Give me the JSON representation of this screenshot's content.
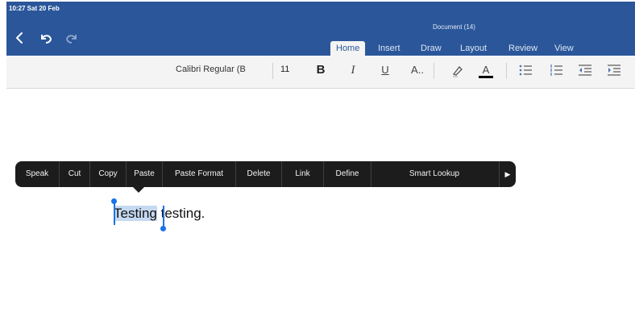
{
  "status_bar": {
    "time": "10:27  Sat 20 Feb"
  },
  "document_title": "Document (14)",
  "nav": {
    "back_icon": "chevron-left-icon",
    "undo_icon": "undo-icon",
    "redo_icon": "redo-icon"
  },
  "tabs": [
    {
      "label": "Home",
      "active": true
    },
    {
      "label": "Insert",
      "active": false
    },
    {
      "label": "Draw",
      "active": false
    },
    {
      "label": "Layout",
      "active": false
    },
    {
      "label": "Review",
      "active": false
    },
    {
      "label": "View",
      "active": false
    }
  ],
  "ribbon": {
    "font_name": "Calibri Regular (B",
    "font_size": "11",
    "bold": "B",
    "italic": "I",
    "underline": "U",
    "font_more": "A..",
    "highlight_icon": "highlighter-icon",
    "font_color": "A",
    "font_color_hex": "#000000",
    "bullets_icon": "bulleted-list-icon",
    "numbering_icon": "numbered-list-icon",
    "outdent_icon": "decrease-indent-icon",
    "indent_icon": "increase-indent-icon"
  },
  "context_menu": {
    "items": [
      "Speak",
      "Cut",
      "Copy",
      "Paste",
      "Paste Format",
      "Delete",
      "Link",
      "Define",
      "Smart Lookup"
    ],
    "more_icon": "play-right-icon"
  },
  "document": {
    "selected_text": "Testing",
    "rest_text": " testing."
  },
  "colors": {
    "word_blue": "#2b579a",
    "selection": "#c5d9f1",
    "handle": "#1a73e8",
    "menu_bg": "#1c1c1c"
  }
}
